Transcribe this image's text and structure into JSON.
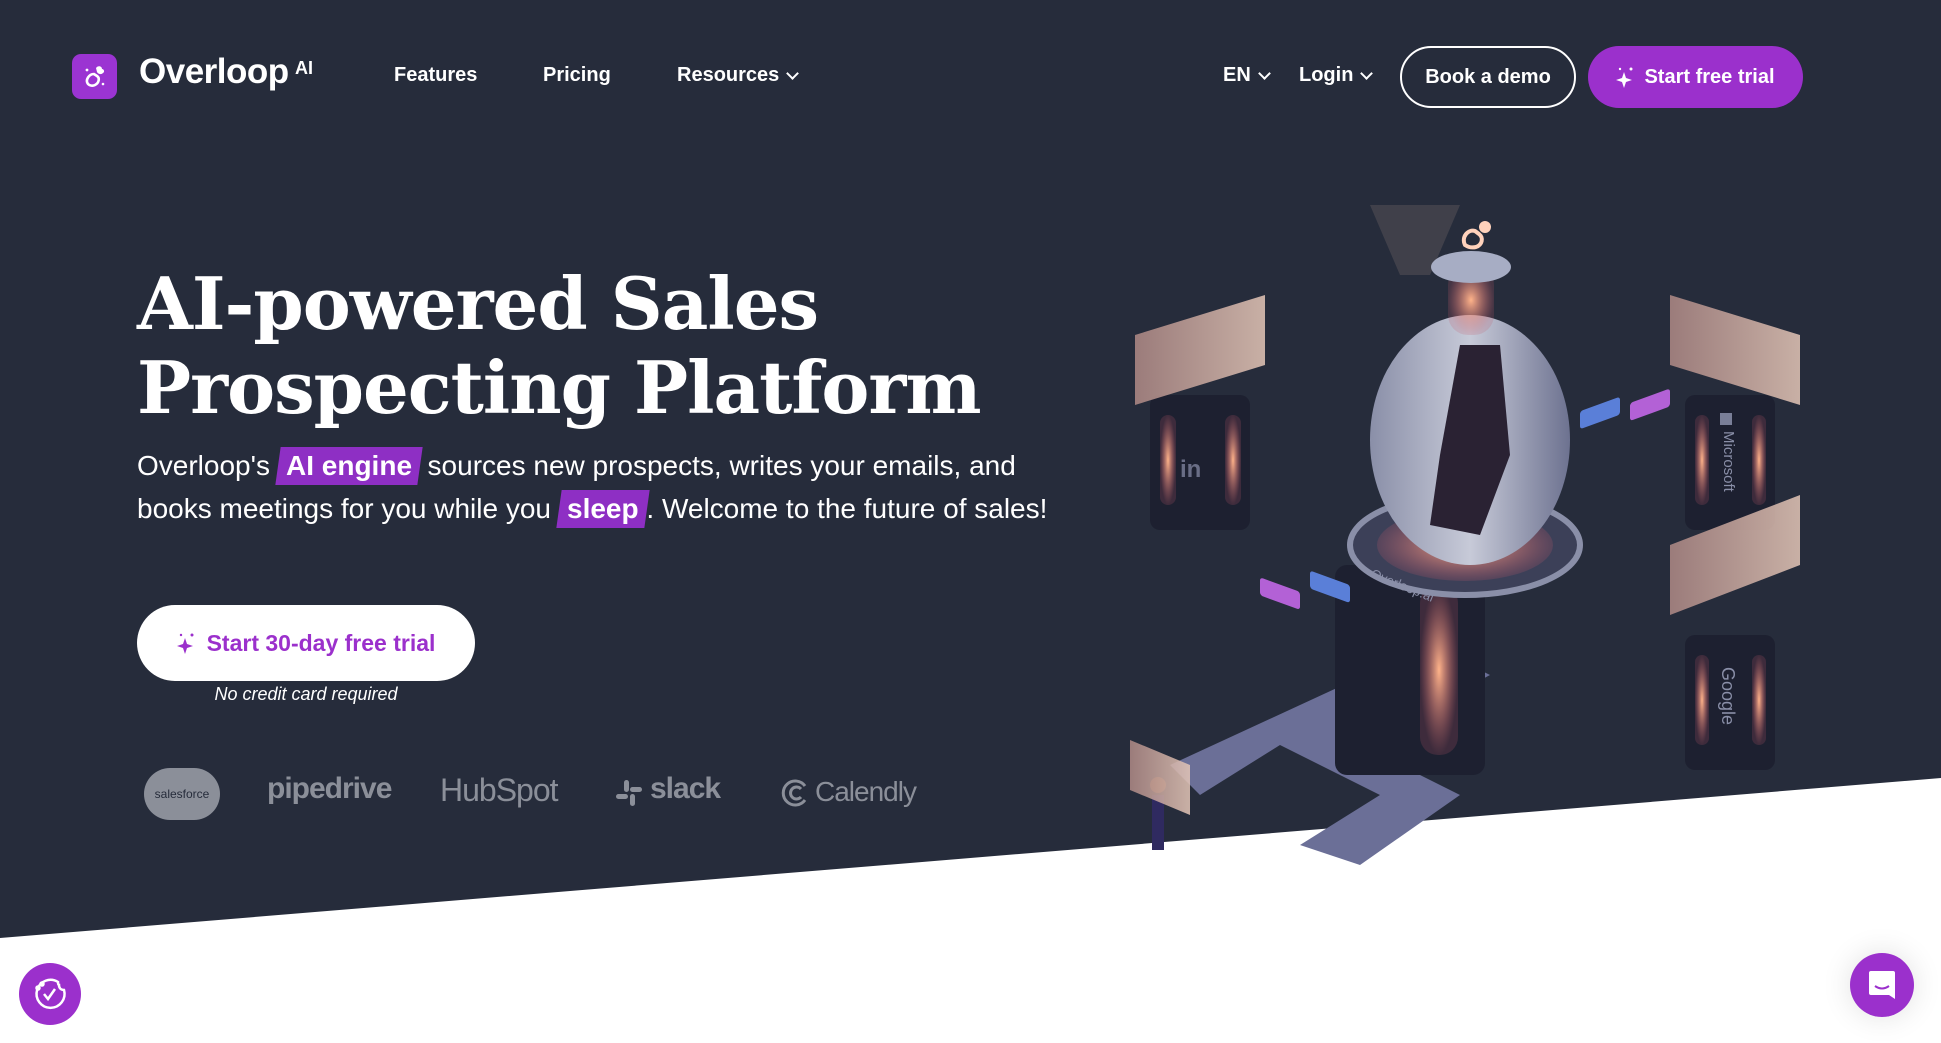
{
  "colors": {
    "background": "#262c3b",
    "brand_purple": "#9b30cc",
    "logo_gray": "#8b8f99"
  },
  "header": {
    "logo_text": "Overloop",
    "logo_suffix": "AI",
    "nav": [
      {
        "label": "Features"
      },
      {
        "label": "Pricing"
      },
      {
        "label": "Resources",
        "has_dropdown": true
      }
    ],
    "language": "EN",
    "login": "Login",
    "book_demo": "Book a demo",
    "start_trial": "Start free trial"
  },
  "hero": {
    "title_line1": "AI-powered Sales",
    "title_line2": "Prospecting Platform",
    "para_1": "Overloop's ",
    "highlight_1": "AI engine",
    "para_2": " sources new prospects, writes your emails, and books meetings for you while you ",
    "highlight_2": "sleep",
    "para_3": ". Welcome to the future of sales!",
    "cta": "Start 30-day free trial",
    "cta_note": "No credit card required"
  },
  "integrations": [
    "salesforce",
    "pipedrive",
    "HubSpot",
    "slack",
    "Calendly"
  ],
  "illustration": {
    "pillar_labels": [
      "in",
      "Microsoft",
      "Google"
    ],
    "machine_label": "Overloop.ai"
  },
  "widgets": {
    "cookie_icon": "cookie-check-icon",
    "chat_icon": "chat-bubble-icon"
  }
}
